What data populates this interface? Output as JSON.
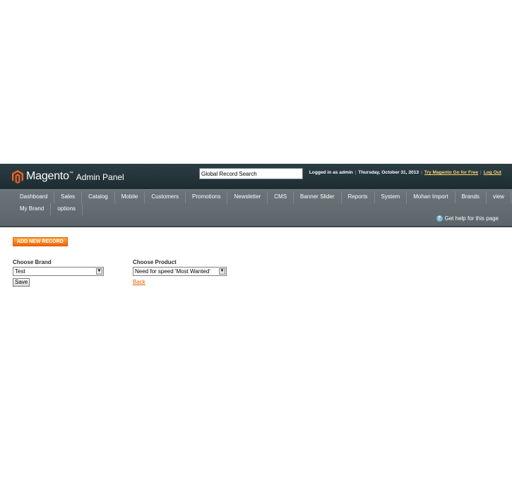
{
  "header": {
    "brand_name": "Magento",
    "brand_tm": "™",
    "brand_suffix": "Admin Panel",
    "search_value": "Global Record Search",
    "logged_in": "Logged in as admin",
    "date": "Thursday, October 31, 2013",
    "try_link": "Try Magento Go for Free",
    "logout_link": "Log Out"
  },
  "nav": {
    "row1": [
      "Dashboard",
      "Sales",
      "Catalog",
      "Mobile",
      "Customers",
      "Promotions",
      "Newsletter",
      "CMS",
      "Banner Slider",
      "Reports",
      "System",
      "Mohan Import",
      "Brands",
      "view"
    ],
    "row2": [
      "My Brand",
      "options"
    ],
    "help": "Get help for this page"
  },
  "form": {
    "add_button": "ADD NEW RECORD",
    "brand_label": "Choose Brand",
    "brand_selected": "Test",
    "product_label": "Choose Product",
    "product_selected": "Need for speed 'Most Wanted'",
    "save_button": "Save",
    "back_link": "Back"
  },
  "colors": {
    "header_bg": "#1d2c31",
    "nav_bg": "#5b656a",
    "accent_orange": "#ed6502",
    "link_yellow": "#ffd36e"
  },
  "icons": {
    "logo": "magento-logo-icon",
    "help": "help-icon",
    "dropdown": "chevron-down-icon"
  }
}
